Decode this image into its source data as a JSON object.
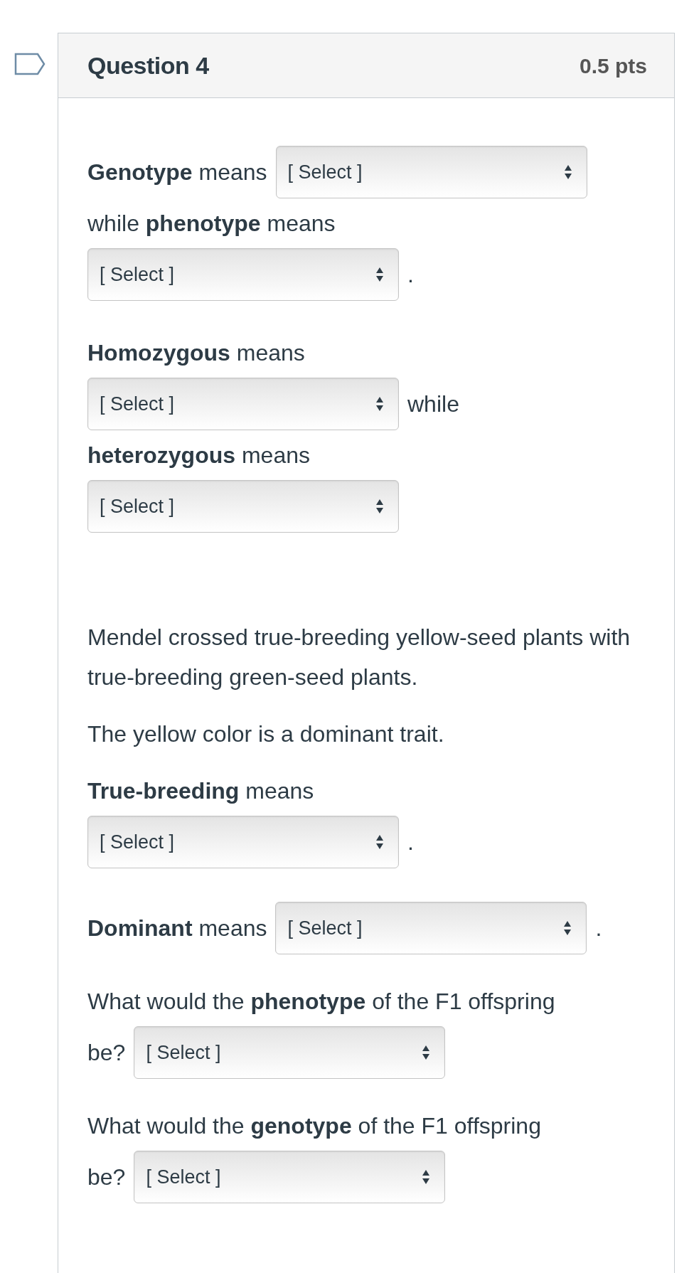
{
  "question": {
    "title": "Question 4",
    "points": "0.5 pts",
    "paragraphs": [
      {
        "kind": "lines",
        "lines": [
          [
            {
              "kind": "text",
              "text": "**Genotype** means"
            },
            {
              "kind": "select",
              "value": "[ Select ]"
            }
          ],
          [
            {
              "kind": "text",
              "text": "while **phenotype** means"
            }
          ],
          [
            {
              "kind": "select",
              "value": "[ Select ]"
            },
            {
              "kind": "text",
              "text": "."
            }
          ]
        ]
      },
      {
        "kind": "lines",
        "lines": [
          [
            {
              "kind": "text",
              "text": "**Homozygous** means"
            }
          ],
          [
            {
              "kind": "select",
              "value": "[ Select ]"
            },
            {
              "kind": "text",
              "text": "while"
            }
          ],
          [
            {
              "kind": "text",
              "text": "**heterozygous** means"
            }
          ],
          [
            {
              "kind": "select",
              "value": "[ Select ]"
            }
          ]
        ]
      },
      {
        "kind": "prose",
        "text": "Mendel crossed true-breeding yellow-seed plants with true-breeding green-seed plants."
      },
      {
        "kind": "prose",
        "text": "The yellow color is a dominant trait."
      },
      {
        "kind": "lines",
        "lines": [
          [
            {
              "kind": "text",
              "text": "**True-breeding** means"
            }
          ],
          [
            {
              "kind": "select",
              "value": "[ Select ]"
            },
            {
              "kind": "text",
              "text": "."
            }
          ]
        ]
      },
      {
        "kind": "lines",
        "lines": [
          [
            {
              "kind": "text",
              "text": "**Dominant** means"
            },
            {
              "kind": "select",
              "value": "[ Select ]"
            },
            {
              "kind": "text",
              "text": "."
            }
          ]
        ]
      },
      {
        "kind": "lines",
        "lines": [
          [
            {
              "kind": "text",
              "text": "What would the **phenotype** of the F1 offspring"
            }
          ],
          [
            {
              "kind": "text",
              "text": "be?"
            },
            {
              "kind": "select",
              "value": "[ Select ]"
            }
          ]
        ]
      },
      {
        "kind": "lines",
        "lines": [
          [
            {
              "kind": "text",
              "text": "What would the **genotype** of the F1 offspring"
            }
          ],
          [
            {
              "kind": "text",
              "text": "be?"
            },
            {
              "kind": "select",
              "value": "[ Select ]"
            }
          ]
        ]
      }
    ]
  }
}
